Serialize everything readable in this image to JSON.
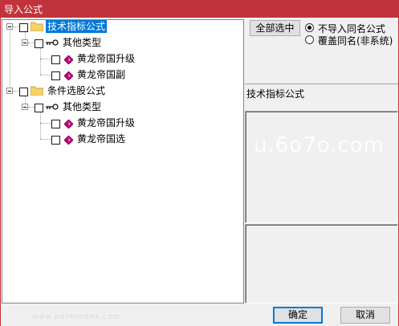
{
  "window": {
    "title": "导入公式"
  },
  "tree": {
    "root1": {
      "label": "技术指标公式",
      "child": {
        "label": "其他类型",
        "items": [
          "黄龙帝国升级",
          "黄龙帝国副"
        ]
      }
    },
    "root2": {
      "label": "条件选股公式",
      "child": {
        "label": "其他类型",
        "items": [
          "黄龙帝国升级",
          "黄龙帝国选"
        ]
      }
    }
  },
  "actions": {
    "select_all": "全部选中",
    "ok": "确定",
    "cancel": "取消"
  },
  "options": {
    "no_import_same_name": "不导入同名公式",
    "overwrite_same_name": "覆盖同名(非系统)",
    "selected": "no_import_same_name"
  },
  "detail": {
    "formula_type": "技术指标公式"
  },
  "watermark": {
    "main": "u.6o7o.com",
    "footer": "www.palmindex.com"
  },
  "colors": {
    "titlebar": "#c1333a",
    "selection": "#0078d7",
    "folder": "#f5d36b",
    "gem": "#c0007a"
  }
}
